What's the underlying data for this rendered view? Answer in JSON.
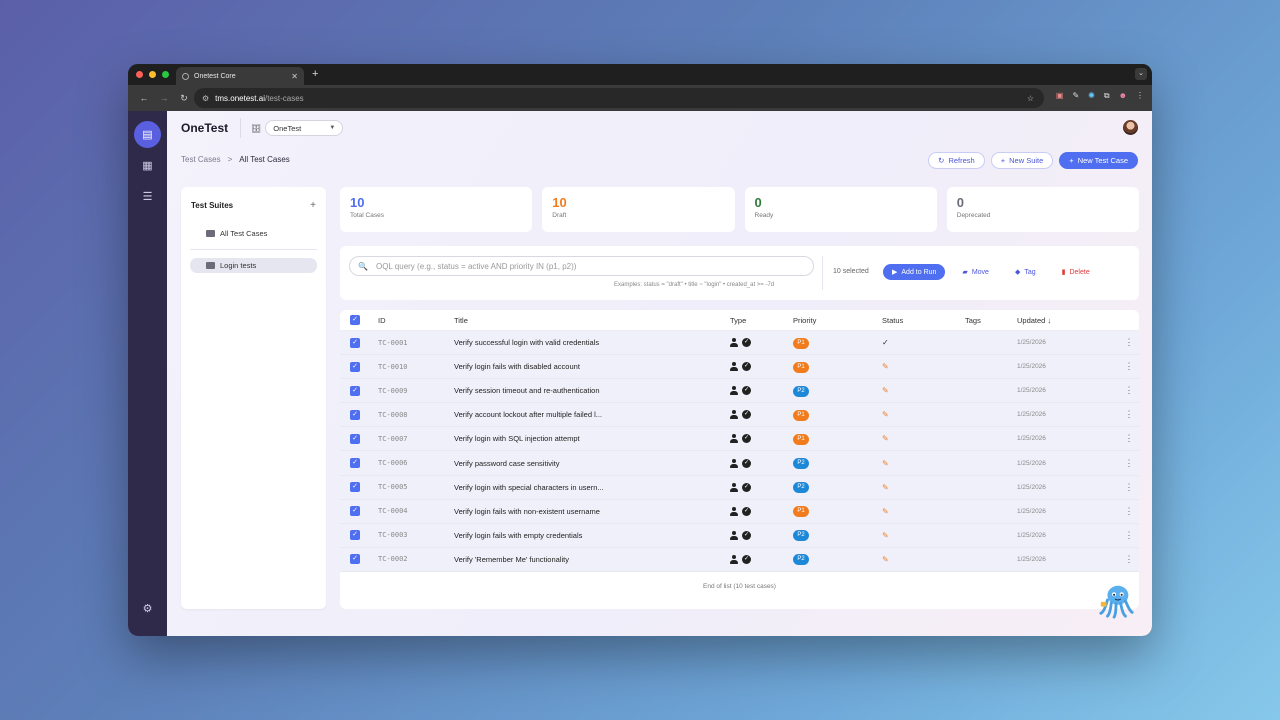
{
  "browser": {
    "tab_title": "Onetest Core",
    "url_domain": "tms.onetest.ai",
    "url_path": "/test-cases"
  },
  "app": {
    "brand": "OneTest",
    "project": "OneTest"
  },
  "breadcrumb": {
    "parent": "Test Cases",
    "separator": ">",
    "current": "All Test Cases"
  },
  "actions": {
    "refresh": "Refresh",
    "new_suite": "New Suite",
    "new_case": "New Test Case"
  },
  "suites": {
    "title": "Test Suites",
    "add": "+",
    "items": [
      {
        "label": "All Test Cases",
        "selected": false
      },
      {
        "label": "Login tests",
        "selected": true
      }
    ]
  },
  "stats": [
    {
      "value": "10",
      "label": "Total Cases",
      "color": "#4f6ef0"
    },
    {
      "value": "10",
      "label": "Draft",
      "color": "#f07c1e"
    },
    {
      "value": "0",
      "label": "Ready",
      "color": "#2f7a3a"
    },
    {
      "value": "0",
      "label": "Deprecated",
      "color": "#6b6b7a"
    }
  ],
  "filter": {
    "placeholder": "OQL query (e.g., status = active AND priority IN (p1, p2))",
    "examples": "Examples: status = \"draft\" • title ~ \"login\" • created_at >= -7d",
    "selected_count": "10 selected",
    "add_to_run": "Add to Run",
    "move": "Move",
    "tag": "Tag",
    "delete": "Delete"
  },
  "table": {
    "columns": {
      "id": "ID",
      "title": "Title",
      "type": "Type",
      "priority": "Priority",
      "status": "Status",
      "tags": "Tags",
      "updated": "Updated ↓"
    },
    "rows": [
      {
        "id": "TC-0001",
        "title": "Verify successful login with valid credentials",
        "priority": "P1",
        "status": "✓",
        "tags": "",
        "updated": "1/25/2026"
      },
      {
        "id": "TC-0010",
        "title": "Verify login fails with disabled account",
        "priority": "P1",
        "status": "✎",
        "tags": "",
        "updated": "1/25/2026"
      },
      {
        "id": "TC-0009",
        "title": "Verify session timeout and re-authentication",
        "priority": "P2",
        "status": "✎",
        "tags": "",
        "updated": "1/25/2026"
      },
      {
        "id": "TC-0008",
        "title": "Verify account lockout after multiple failed l...",
        "priority": "P1",
        "status": "✎",
        "tags": "",
        "updated": "1/25/2026"
      },
      {
        "id": "TC-0007",
        "title": "Verify login with SQL injection attempt",
        "priority": "P1",
        "status": "✎",
        "tags": "",
        "updated": "1/25/2026"
      },
      {
        "id": "TC-0006",
        "title": "Verify password case sensitivity",
        "priority": "P2",
        "status": "✎",
        "tags": "",
        "updated": "1/25/2026"
      },
      {
        "id": "TC-0005",
        "title": "Verify login with special characters in usern...",
        "priority": "P2",
        "status": "✎",
        "tags": "",
        "updated": "1/25/2026"
      },
      {
        "id": "TC-0004",
        "title": "Verify login fails with non-existent username",
        "priority": "P1",
        "status": "✎",
        "tags": "",
        "updated": "1/25/2026"
      },
      {
        "id": "TC-0003",
        "title": "Verify login fails with empty credentials",
        "priority": "P2",
        "status": "✎",
        "tags": "",
        "updated": "1/25/2026"
      },
      {
        "id": "TC-0002",
        "title": "Verify 'Remember Me' functionality",
        "priority": "P2",
        "status": "✎",
        "tags": "",
        "updated": "1/25/2026"
      }
    ],
    "end_note": "End of list (10 test cases)"
  },
  "colors": {
    "P1": "#f07c1e",
    "P2": "#1e88d8",
    "accent": "#4f6ef0",
    "draft_icon": "#f07c1e"
  },
  "icons": {
    "rail": [
      "test-cases-icon",
      "runs-icon",
      "list-icon",
      "settings-icon"
    ]
  }
}
